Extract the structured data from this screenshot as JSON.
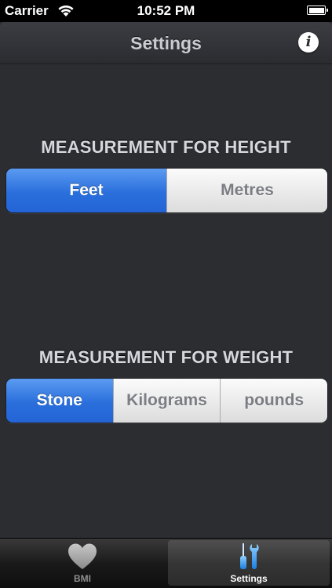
{
  "status_bar": {
    "carrier": "Carrier",
    "time": "10:52 PM"
  },
  "nav": {
    "title": "Settings",
    "info_icon": "info-icon",
    "info_glyph": "i"
  },
  "height_section": {
    "title": "MEASUREMENT FOR HEIGHT",
    "options": [
      "Feet",
      "Metres"
    ],
    "selected": "Feet"
  },
  "weight_section": {
    "title": "MEASUREMENT FOR WEIGHT",
    "options": [
      "Stone",
      "Kilograms",
      "pounds"
    ],
    "selected": "Stone"
  },
  "tab_bar": {
    "tabs": [
      {
        "label": "BMI",
        "icon": "heart-icon"
      },
      {
        "label": "Settings",
        "icon": "tools-icon"
      }
    ],
    "selected": "Settings"
  },
  "colors": {
    "accent": "#2a6fdc",
    "background": "#2b2d31"
  }
}
